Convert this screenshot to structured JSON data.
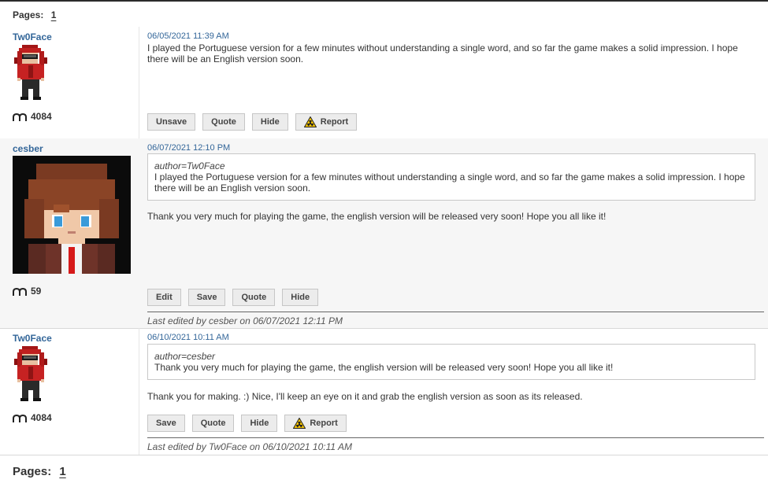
{
  "pagination": {
    "label": "Pages:",
    "current": "1"
  },
  "icons": {
    "points": "m-points-icon",
    "report": "radiation-warning-icon"
  },
  "colors": {
    "author": "#336699",
    "timestamp": "#336699",
    "alt_row": "#f6f6f6"
  },
  "posts": [
    {
      "author": "Tw0Face",
      "points": "4084",
      "timestamp": "06/05/2021 11:39 AM",
      "message": "I played the Portuguese version for a few minutes without understanding a single word, and so far the game makes a solid impression. I hope there will be an English version soon.",
      "buttons": [
        "Unsave",
        "Quote",
        "Hide",
        "Report"
      ]
    },
    {
      "author": "cesber",
      "points": "59",
      "timestamp": "06/07/2021 12:10 PM",
      "quote_author": "author=Tw0Face",
      "quote_text": "I played the Portuguese version for a few minutes without understanding a single word, and so far the game makes a solid impression. I hope there will be an English version soon.",
      "message": "Thank you very much for playing the game, the english version will be released very soon! Hope you all like it!",
      "buttons": [
        "Edit",
        "Save",
        "Quote",
        "Hide"
      ],
      "edited": "Last edited by cesber on 06/07/2021 12:11 PM"
    },
    {
      "author": "Tw0Face",
      "points": "4084",
      "timestamp": "06/10/2021 10:11 AM",
      "quote_author": "author=cesber",
      "quote_text": "Thank you very much for playing the game, the english version will be released very soon! Hope you all like it!",
      "message": "Thank you for making. :) Nice, I'll keep an eye on it and grab the english version as soon as its released.",
      "buttons": [
        "Save",
        "Quote",
        "Hide",
        "Report"
      ],
      "edited": "Last edited by Tw0Face on 06/10/2021 10:11 AM"
    }
  ]
}
